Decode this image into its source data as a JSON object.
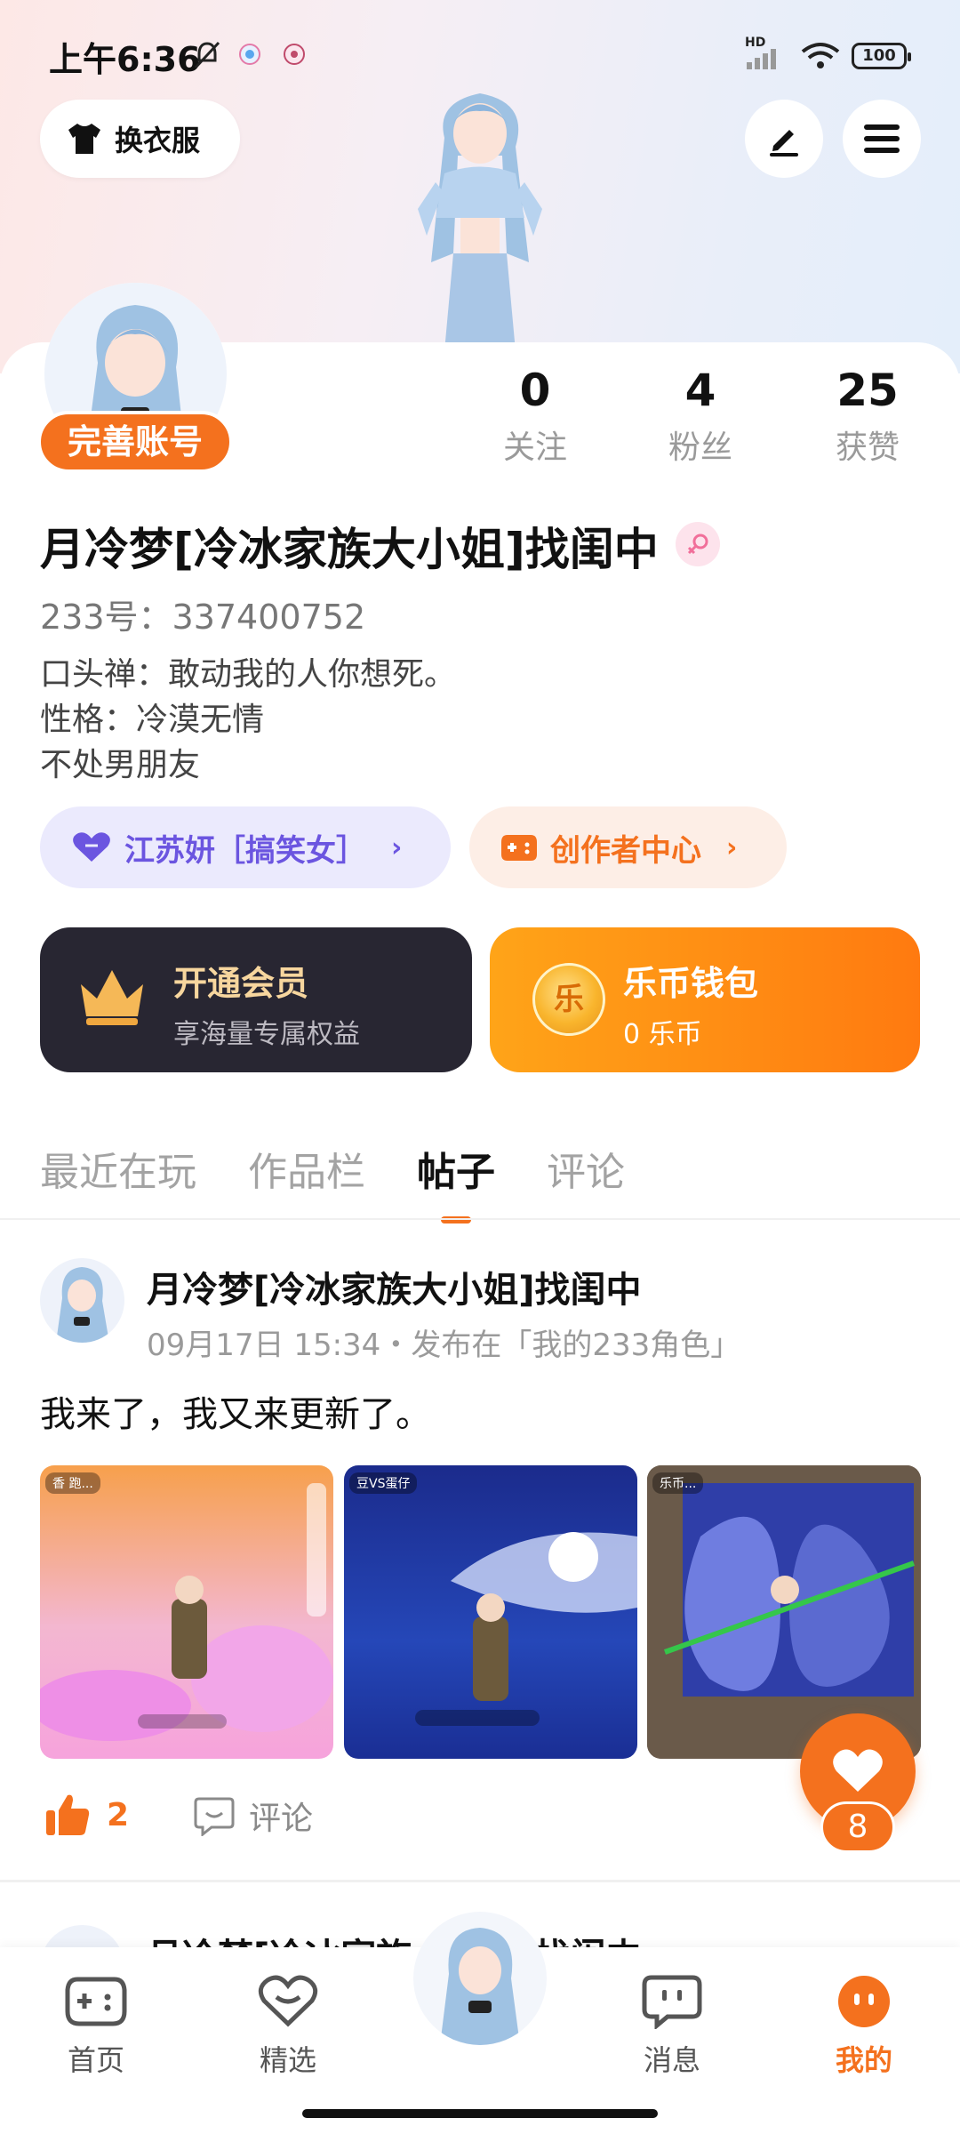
{
  "status_bar": {
    "time": "上午6:36",
    "battery": "100",
    "network": "HD"
  },
  "header": {
    "outfit_label": "换衣服"
  },
  "profile": {
    "complete_label": "完善账号",
    "stats": [
      {
        "value": "0",
        "label": "关注"
      },
      {
        "value": "4",
        "label": "粉丝"
      },
      {
        "value": "25",
        "label": "获赞"
      }
    ],
    "name": "月冷梦[冷冰家族大小姐]找闺中",
    "uid": "233号：337400752",
    "bio": [
      "口头禅：敢动我的人你想死。",
      "性格：冷漠无情",
      "不处男朋友"
    ],
    "relation_pill": "江苏妍［搞笑女］",
    "creator_pill": "创作者中心"
  },
  "cards": {
    "vip_title": "开通会员",
    "vip_sub": "享海量专属权益",
    "wallet_title": "乐币钱包",
    "wallet_sub": "0 乐币",
    "coin_glyph": "乐"
  },
  "tabs": [
    {
      "label": "最近在玩",
      "active": false
    },
    {
      "label": "作品栏",
      "active": false
    },
    {
      "label": "帖子",
      "active": true
    },
    {
      "label": "评论",
      "active": false
    }
  ],
  "post": {
    "author": "月冷梦[冷冰家族大小姐]找闺中",
    "meta": "09月17日 15:34・发布在「我的233角色」",
    "text": "我来了，我又来更新了。",
    "thumb_tags": [
      "香 跑...",
      "豆VS蛋仔",
      "乐币..."
    ],
    "likes": "2",
    "comment_label": "评论"
  },
  "fab": {
    "count": "8"
  },
  "next_post": {
    "author": "月冷梦[冷冰家族大小姐]找闺中"
  },
  "nav": [
    {
      "label": "首页",
      "icon": "gamepad-icon",
      "active": false
    },
    {
      "label": "精选",
      "icon": "heart-chat-icon",
      "active": false
    },
    {
      "label": "消息",
      "icon": "message-icon",
      "active": false
    },
    {
      "label": "我的",
      "icon": "profile-face-icon",
      "active": true
    }
  ],
  "colors": {
    "accent": "#f4711e",
    "vip_bg": "#282632",
    "vip_text": "#f7d69e",
    "relation_bg": "#ebeafd",
    "relation_text": "#6b55e0",
    "creator_bg": "#fdeee6"
  }
}
